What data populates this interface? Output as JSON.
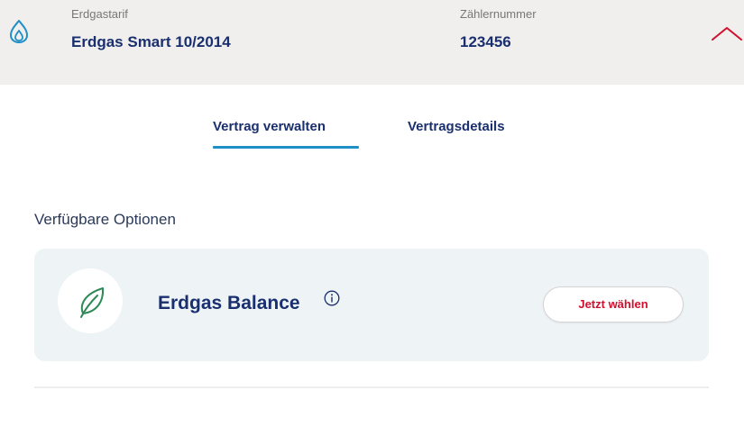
{
  "header": {
    "tariff_label": "Erdgastarif",
    "tariff_value": "Erdgas Smart 10/2014",
    "meter_label": "Zählernummer",
    "meter_value": "123456",
    "icons": {
      "product": "flame-icon",
      "toggle": "chevron-up-icon"
    }
  },
  "tabs": [
    {
      "label": "Vertrag verwalten",
      "active": true
    },
    {
      "label": "Vertragsdetails",
      "active": false
    }
  ],
  "options_section": {
    "title": "Verfügbare Optionen",
    "items": [
      {
        "name": "Erdgas Balance",
        "icon": "leaf-icon",
        "info_icon": "info-icon",
        "button_label": "Jetzt wählen"
      }
    ]
  },
  "colors": {
    "brand_navy": "#1a2f6e",
    "accent_blue": "#1f8fc7",
    "accent_red": "#d0102c",
    "header_bg": "#f0efee",
    "card_bg": "#eef3f6",
    "leaf_green": "#2e8b57"
  }
}
